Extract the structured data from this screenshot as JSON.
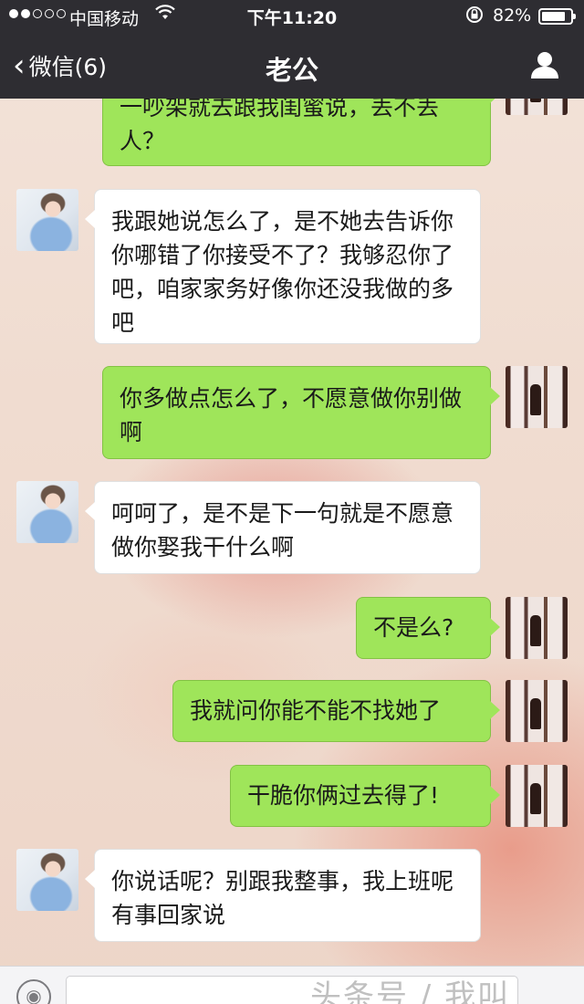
{
  "status_bar": {
    "carrier": "中国移动",
    "time": "下午11:20",
    "battery_text": "82%",
    "battery_level": 0.82
  },
  "nav": {
    "back_label": "微信(6)",
    "title": "老公"
  },
  "messages": [
    {
      "side": "out",
      "text": "一吵架就去跟我闺蜜说，丢不丢人？"
    },
    {
      "side": "in",
      "text": "我跟她说怎么了，是不她去告诉你你哪错了你接受不了？我够忍你了吧，咱家家务好像你还没我做的多吧"
    },
    {
      "side": "out",
      "text": "你多做点怎么了，不愿意做你别做啊"
    },
    {
      "side": "in",
      "text": "呵呵了，是不是下一句就是不愿意做你娶我干什么啊"
    },
    {
      "side": "out",
      "text": "不是么?"
    },
    {
      "side": "out",
      "text": "我就问你能不能不找她了"
    },
    {
      "side": "out",
      "text": "干脆你俩过去得了!"
    },
    {
      "side": "in",
      "text": "你说话呢？别跟我整事，我上班呢 有事回家说"
    }
  ],
  "watermark": "头条号 / 我叫",
  "icons": {
    "back": "chevron-left-icon",
    "profile": "user-icon",
    "voice": "voice-icon",
    "wifi": "wifi-icon",
    "lock": "rotation-lock-icon"
  }
}
